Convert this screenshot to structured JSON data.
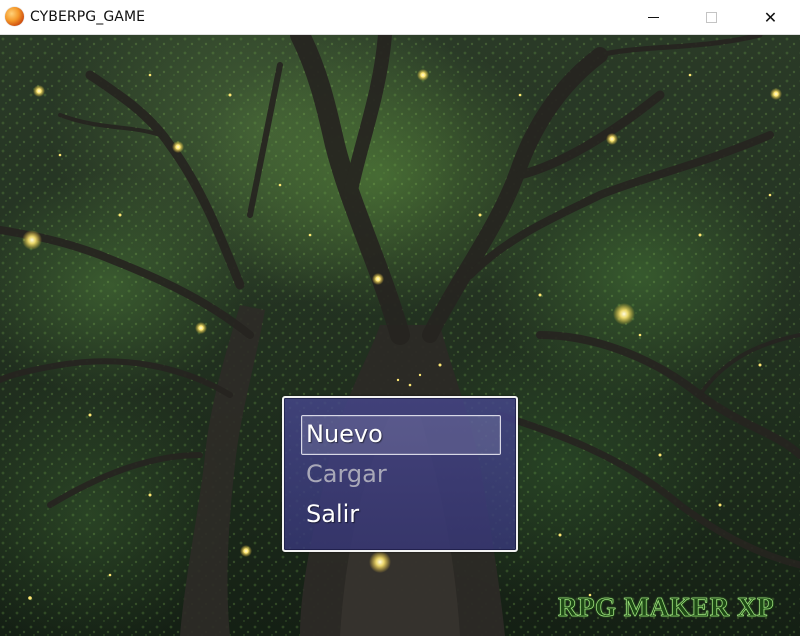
{
  "window": {
    "title": "CYBERPG_GAME",
    "icon": "rpg-maker-orb-icon",
    "controls": {
      "minimize_icon": "minimize-icon",
      "maximize_icon": "maximize-icon",
      "close_icon": "close-icon",
      "close_glyph": "✕"
    }
  },
  "title_menu": {
    "items": [
      {
        "label": "Nuevo",
        "state": "selected"
      },
      {
        "label": "Cargar",
        "state": "disabled"
      },
      {
        "label": "Salir",
        "state": "enabled"
      }
    ],
    "window_color": "#3c3c82",
    "border_color": "#f2f2f2"
  },
  "watermark": {
    "text": "RPG MAKER XP",
    "color": "#1e4a16",
    "glow_color": "#a8ec86"
  },
  "scene": {
    "background": "forest-night-fireflies",
    "firefly_color": "#ffe873"
  }
}
